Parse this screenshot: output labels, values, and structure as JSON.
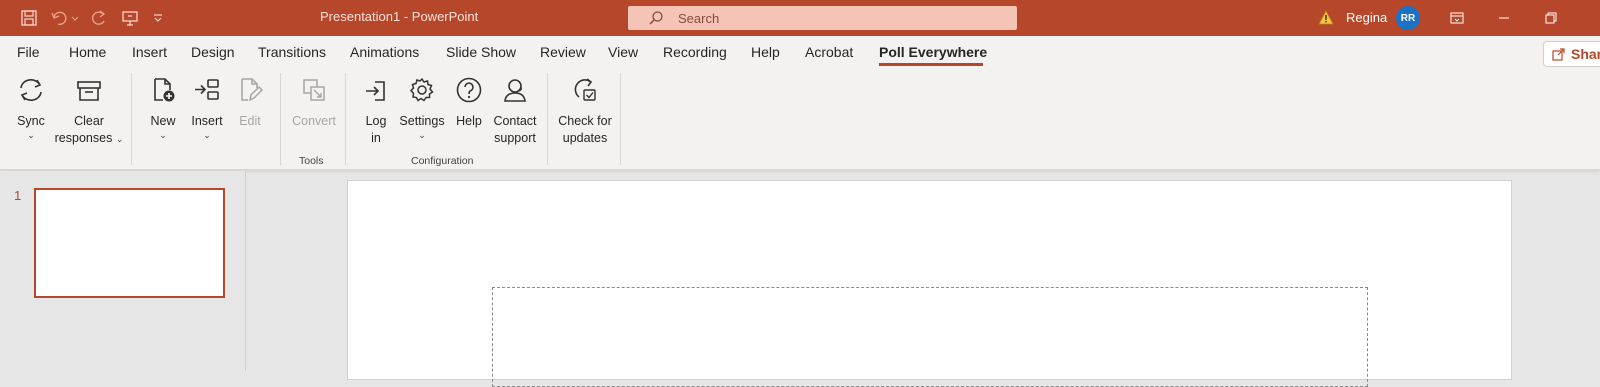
{
  "app": {
    "title": "Presentation1  -  PowerPoint",
    "search_placeholder": "Search",
    "user_name": "Regina",
    "user_initials": "RR",
    "accent": "#b7472a"
  },
  "menu": {
    "tabs": [
      {
        "label": "File"
      },
      {
        "label": "Home"
      },
      {
        "label": "Insert"
      },
      {
        "label": "Design"
      },
      {
        "label": "Transitions"
      },
      {
        "label": "Animations"
      },
      {
        "label": "Slide Show"
      },
      {
        "label": "Review"
      },
      {
        "label": "View"
      },
      {
        "label": "Recording"
      },
      {
        "label": "Help"
      },
      {
        "label": "Acrobat"
      },
      {
        "label": "Poll Everywhere",
        "active": true
      }
    ],
    "share_label": "Share"
  },
  "ribbon": {
    "sync_label": "Sync",
    "clear_label_1": "Clear",
    "clear_label_2": "responses",
    "new_label": "New",
    "insert_label": "Insert",
    "edit_label": "Edit",
    "convert_label": "Convert",
    "tools_group": "Tools",
    "login_label_1": "Log",
    "login_label_2": "in",
    "settings_label": "Settings",
    "help_label": "Help",
    "contact_label_1": "Contact",
    "contact_label_2": "support",
    "configuration_group": "Configuration",
    "check_label_1": "Check for",
    "check_label_2": "updates"
  },
  "slides": {
    "current_number": "1"
  }
}
